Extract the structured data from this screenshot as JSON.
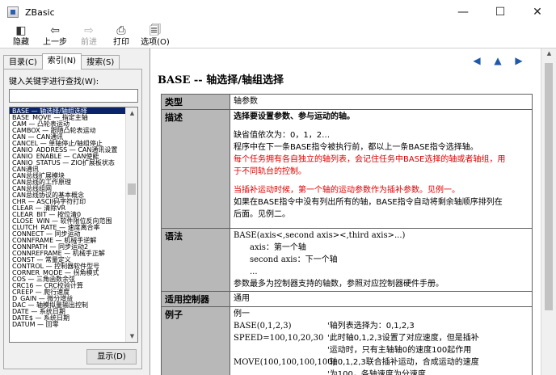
{
  "window": {
    "title": "ZBasic",
    "controls": {
      "minimize": "—",
      "maximize": "☐",
      "close": "✕"
    }
  },
  "toolbar": {
    "hide": "隐藏",
    "back": "上一步",
    "forward": "前进",
    "print": "打印",
    "options": "选项(O)"
  },
  "left": {
    "tabs": [
      "目录(C)",
      "索引(N)",
      "搜索(S)"
    ],
    "active_tab": 1,
    "search_label": "键入关键字进行查找(W):",
    "search_value": "",
    "index_items": [
      "BASE — 轴选择/轴组选择",
      "BASE_MOVE — 指定主轴",
      "CAM — 凸轮表运动",
      "CAMBOX — 跟随凸轮表运动",
      "CAN — CAN通讯",
      "CANCEL — 单轴停止/轴组停止",
      "CANIO_ADDRESS — CAN通讯设置",
      "CANIO_ENABLE — CAN使能",
      "CANIO_STATUS — ZIO扩展板状态",
      "CAN通讯",
      "CAN总线扩展模块",
      "CAN总线的工作原理",
      "CAN总线组网",
      "CAN总线协议的基本概念",
      "CHR — ASCII码字符打印",
      "CLEAR — 清除VR",
      "CLEAR_BIT — 按位清0",
      "CLOSE_WIN — 软件限位反向范围",
      "CLUTCH_RATE — 速度离合率",
      "CONNECT — 同步运动",
      "CONNFRAME — 机械手逆解",
      "CONNPATH — 同步运动2",
      "CONNREFRAME — 机械手正解",
      "CONST — 常量定义",
      "CONTROL — 控制器软件型号",
      "CORNER_MODE — 拐角模式",
      "COS — 三角函数余弦",
      "CRC16 — CRC校验计算",
      "CREEP — 爬行速度",
      "D_GAIN — 微分增益",
      "DAC — 轴模拟量输出控制",
      "DATE — 系统日期",
      "DATE$ — 系统日期",
      "DATUM — 回零"
    ],
    "show_button": "显示(D)"
  },
  "content": {
    "nav_icons": [
      "arrow-left-icon",
      "arrow-up-icon",
      "arrow-right-icon"
    ],
    "title": "BASE -- 轴选择/轴组选择",
    "type_label": "类型",
    "type_value": "轴参数",
    "desc_label": "描述",
    "desc": {
      "line1": "选择要设置参数、参与运动的轴。",
      "line2": "缺省值依次为：0，1，2…",
      "line3": "程序中在下一条BASE指令被执行前，都以上一条BASE指令选择轴。",
      "line4": "每个任务拥有各自独立的轴列表，会记住任务中BASE选择的轴或者轴组，用",
      "line5": "于不同轨台的控制。",
      "line6": "当插补运动时候，第一个轴的运动参数作为插补参数。见例一。",
      "line7": "如果在BASE指令中没有列出所有的轴，BASE指令自动将剩余轴顺序排列在",
      "line8": "后面。见例二。"
    },
    "syntax_label": "语法",
    "syntax": {
      "line1": "BASE(axis<,second axis><,third axis>...)",
      "line2": "axis：第一个轴",
      "line3": "second axis：下一个轴",
      "line4": "...",
      "line5": "参数最多为控制器支持的轴数，参照对应控制器硬件手册。"
    },
    "applicable_label": "适用控制器",
    "applicable_value": "通用",
    "example_label": "例子",
    "example": {
      "heading": "例一",
      "rows": [
        {
          "code": "BASE(0,1,2,3)",
          "comment": "'轴列表选择为：0,1,2,3"
        },
        {
          "code": "SPEED=100,10,20,30",
          "comment": "'此时轴0,1,2,3设置了对应速度，但是插补"
        },
        {
          "code": "",
          "comment": "'运动时，只有主轴轴0的速度100起作用"
        },
        {
          "code": "MOVE(100,100,100,100)",
          "comment": "'轴0,1,2,3联合插补运动，合成运动的速度"
        },
        {
          "code": "",
          "comment": "'为100，各轴速度为分速度"
        }
      ]
    }
  }
}
